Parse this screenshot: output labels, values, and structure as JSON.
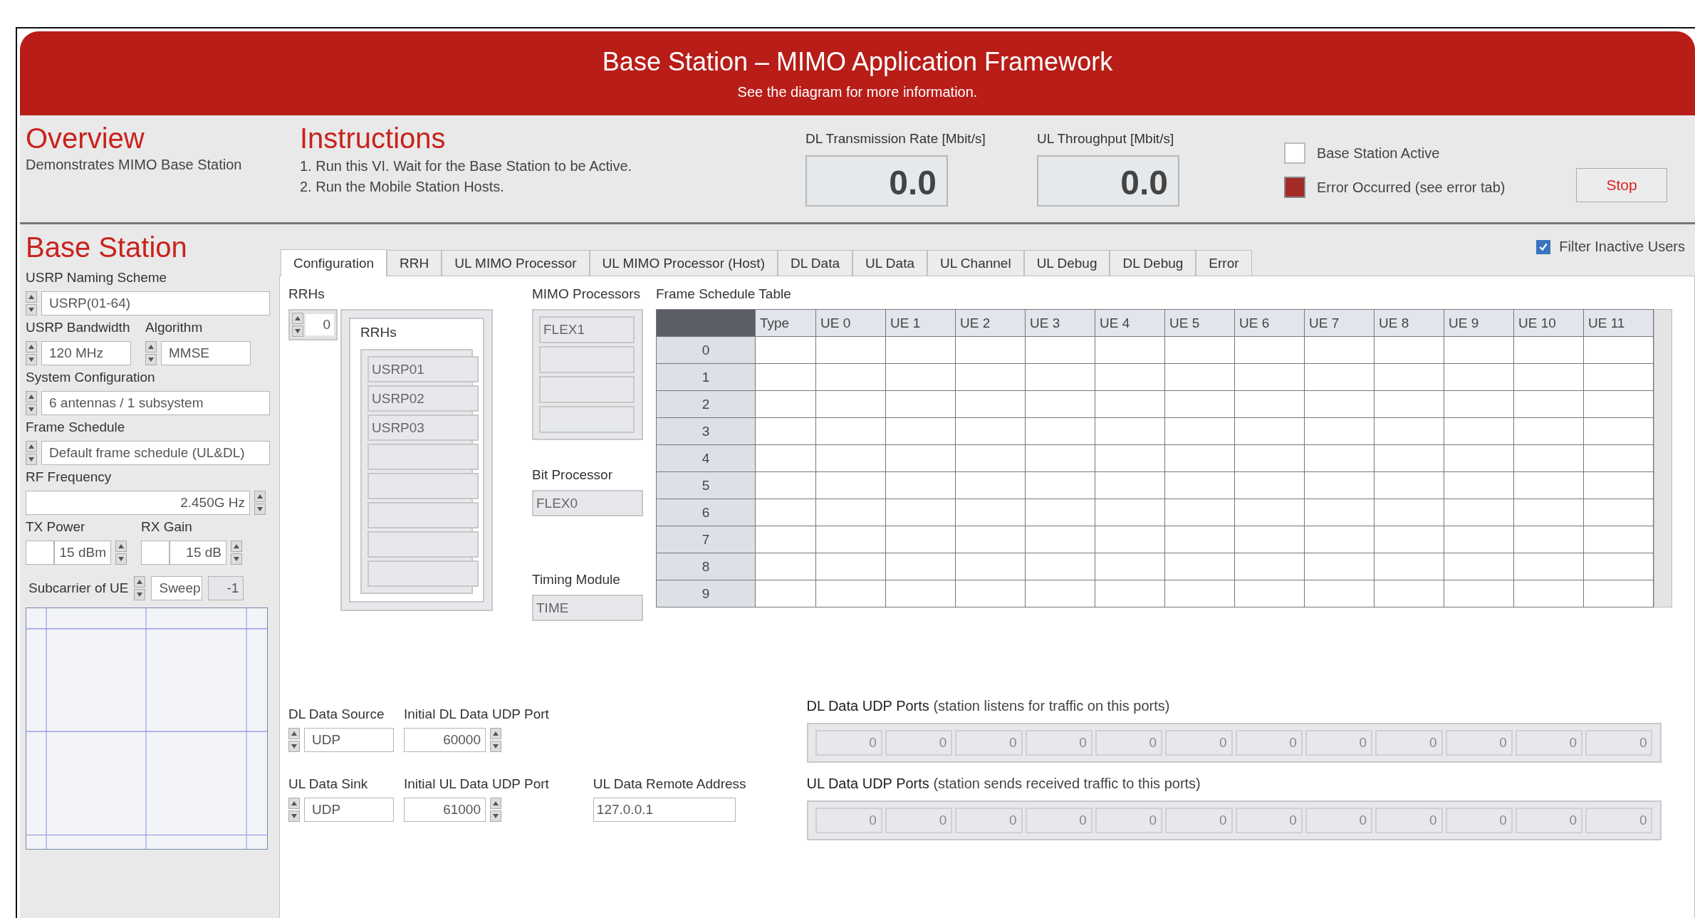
{
  "header": {
    "title": "Base Station – MIMO Application Framework",
    "subtitle": "See the diagram for more information."
  },
  "overview": {
    "title": "Overview",
    "text": "Demonstrates MIMO Base Station"
  },
  "instructions": {
    "title": "Instructions",
    "steps": [
      "1. Run this VI. Wait for the Base Station to be Active.",
      "2. Run the Mobile Station Hosts."
    ]
  },
  "indicators": [
    {
      "label": "DL Transmission Rate [Mbit/s]",
      "value": "0.0"
    },
    {
      "label": "UL Throughput [Mbit/s]",
      "value": "0.0"
    }
  ],
  "leds": [
    {
      "label": "Base Station Active",
      "on": false
    },
    {
      "label": "Error Occurred (see error tab)",
      "on": true
    }
  ],
  "stop_button": "Stop",
  "sidebar": {
    "title": "Base Station",
    "rows": [
      {
        "fields": [
          {
            "kind": "ring",
            "label": "USRP Naming Scheme",
            "value": "USRP(01-64)"
          }
        ]
      },
      {
        "fields": [
          {
            "kind": "ring",
            "label": "USRP Bandwidth",
            "value": "120 MHz"
          },
          {
            "kind": "ring",
            "label": "Algorithm",
            "value": "MMSE"
          }
        ]
      },
      {
        "fields": [
          {
            "kind": "ring",
            "label": "System Configuration",
            "value": "6 antennas / 1 subsystem"
          }
        ]
      },
      {
        "fields": [
          {
            "kind": "ring",
            "label": "Frame Schedule",
            "value": "Default frame schedule (UL&DL)"
          }
        ]
      },
      {
        "fields": [
          {
            "kind": "numeric",
            "label": "RF Frequency",
            "value": "2.450G Hz"
          }
        ]
      },
      {
        "fields": [
          {
            "kind": "unit",
            "label": "TX Power",
            "value": "15 dBm"
          },
          {
            "kind": "unit",
            "label": "RX Gain",
            "value": "15 dB"
          }
        ]
      }
    ],
    "subcarrier": {
      "label": "Subcarrier of UE",
      "value": "Sweep",
      "readout": "-1"
    }
  },
  "tabs": [
    {
      "label": "Configuration",
      "selected": true
    },
    {
      "label": "RRH",
      "selected": false
    },
    {
      "label": "UL MIMO Processor",
      "selected": false
    },
    {
      "label": "UL MIMO Processor (Host)",
      "selected": false
    },
    {
      "label": "DL Data",
      "selected": false
    },
    {
      "label": "UL Data",
      "selected": false
    },
    {
      "label": "UL Channel",
      "selected": false
    },
    {
      "label": "UL Debug",
      "selected": false
    },
    {
      "label": "DL Debug",
      "selected": false
    },
    {
      "label": "Error",
      "selected": false
    }
  ],
  "filter": {
    "label": "Filter Inactive Users",
    "checked": true
  },
  "rrhs": {
    "label": "RRHs",
    "index": "0",
    "inner_label": "RRHs",
    "items": [
      "USRP01",
      "USRP02",
      "USRP03"
    ]
  },
  "mimo_processors": {
    "label": "MIMO Processors",
    "items": [
      "FLEX1"
    ]
  },
  "bit_processor": {
    "label": "Bit Processor",
    "value": "FLEX0"
  },
  "timing_module": {
    "label": "Timing Module",
    "value": "TIME"
  },
  "frame_table": {
    "title": "Frame Schedule Table",
    "columns": [
      "Type",
      "UE 0",
      "UE 1",
      "UE 2",
      "UE 3",
      "UE 4",
      "UE 5",
      "UE 6",
      "UE 7",
      "UE 8",
      "UE 9",
      "UE 10",
      "UE 11"
    ],
    "rows": [
      "0",
      "1",
      "2",
      "3",
      "4",
      "5",
      "6",
      "7",
      "8",
      "9"
    ]
  },
  "data_settings": [
    {
      "fields": [
        {
          "kind": "ring",
          "label": "DL Data Source",
          "value": "UDP"
        },
        {
          "kind": "numeric",
          "label": "Initial DL Data UDP Port",
          "value": "60000"
        }
      ]
    },
    {
      "fields": [
        {
          "kind": "ring",
          "label": "UL Data Sink",
          "value": "UDP"
        },
        {
          "kind": "numeric",
          "label": "Initial UL Data UDP Port",
          "value": "61000"
        },
        {
          "kind": "text",
          "label": "UL Data Remote Address",
          "value": "127.0.0.1"
        }
      ]
    }
  ],
  "port_arrays": [
    {
      "title": "DL Data UDP Ports",
      "note": "(station listens for traffic on this ports)",
      "values": [
        "0",
        "0",
        "0",
        "0",
        "0",
        "0",
        "0",
        "0",
        "0",
        "0",
        "0",
        "0"
      ]
    },
    {
      "title": "UL Data UDP Ports",
      "note": "(station sends received traffic to this ports)",
      "values": [
        "0",
        "0",
        "0",
        "0",
        "0",
        "0",
        "0",
        "0",
        "0",
        "0",
        "0",
        "0"
      ]
    }
  ]
}
